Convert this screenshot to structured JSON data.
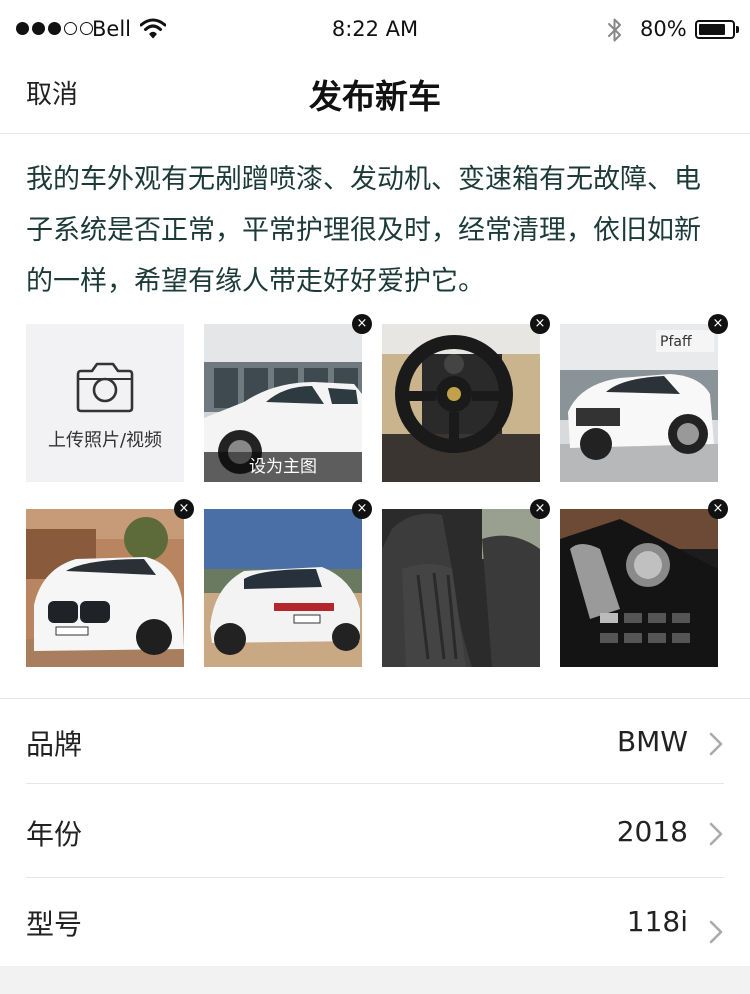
{
  "status_bar": {
    "carrier": "Bell",
    "time": "8:22 AM",
    "battery_percent": "80%",
    "battery_level": 0.8,
    "signal_bars_filled": 3,
    "signal_bars_total": 5
  },
  "nav": {
    "cancel_label": "取消",
    "title": "发布新车"
  },
  "description": "我的车外观有无剐蹭喷漆、发动机、变速箱有无故障、电子系统是否正常，平常护理很及时，经常清理，依旧如新的一样，希望有缘人带走好好爱护它。",
  "photos": {
    "upload_label": "上传照片/视频",
    "set_main_label": "设为主图",
    "delete_icon": "×",
    "items": [
      "white-suv-side",
      "porsche-steering-wheel",
      "white-porsche-macan",
      "white-bmw-x5-front",
      "white-bmw-x5-rear",
      "black-leather-seat",
      "bmw-center-console"
    ]
  },
  "form": {
    "rows": [
      {
        "label": "品牌",
        "value": "BMW"
      },
      {
        "label": "年份",
        "value": "2018"
      },
      {
        "label": "型号",
        "value": "118i"
      }
    ]
  },
  "colors": {
    "description_text": "#1c3a38",
    "upload_bg": "#f2f2f4",
    "divider": "#e6e6e6"
  }
}
